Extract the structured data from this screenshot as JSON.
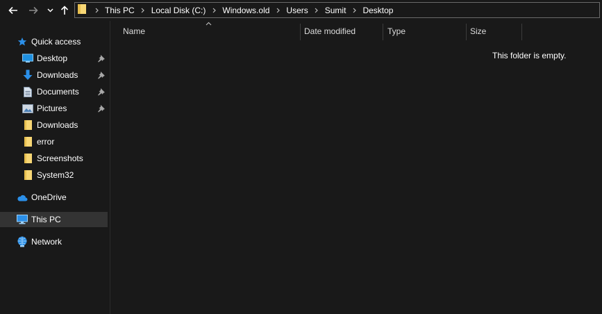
{
  "nav": {
    "back_icon": "arrow-left-icon",
    "forward_icon": "arrow-right-icon",
    "recent_icon": "chevron-down-icon",
    "up_icon": "arrow-up-icon"
  },
  "address": {
    "breadcrumbs": [
      "This PC",
      "Local Disk (C:)",
      "Windows.old",
      "Users",
      "Sumit",
      "Desktop"
    ]
  },
  "sidebar": {
    "quick_access": "Quick access",
    "items": [
      {
        "label": "Desktop",
        "icon": "desktop-icon",
        "pinned": true
      },
      {
        "label": "Downloads",
        "icon": "download-icon",
        "pinned": true
      },
      {
        "label": "Documents",
        "icon": "document-icon",
        "pinned": true
      },
      {
        "label": "Pictures",
        "icon": "pictures-icon",
        "pinned": true
      },
      {
        "label": "Downloads",
        "icon": "folder-icon",
        "pinned": false
      },
      {
        "label": "error",
        "icon": "folder-icon",
        "pinned": false
      },
      {
        "label": "Screenshots",
        "icon": "folder-icon",
        "pinned": false
      },
      {
        "label": "System32",
        "icon": "folder-icon",
        "pinned": false
      }
    ],
    "onedrive": "OneDrive",
    "this_pc": "This PC",
    "network": "Network"
  },
  "content": {
    "columns": [
      "Name",
      "Date modified",
      "Type",
      "Size"
    ],
    "empty_message": "This folder is empty."
  },
  "colors": {
    "background": "#191919",
    "selected": "#333333",
    "accent": "#0078d7",
    "folder": "#f8d775",
    "text": "#ffffff"
  }
}
